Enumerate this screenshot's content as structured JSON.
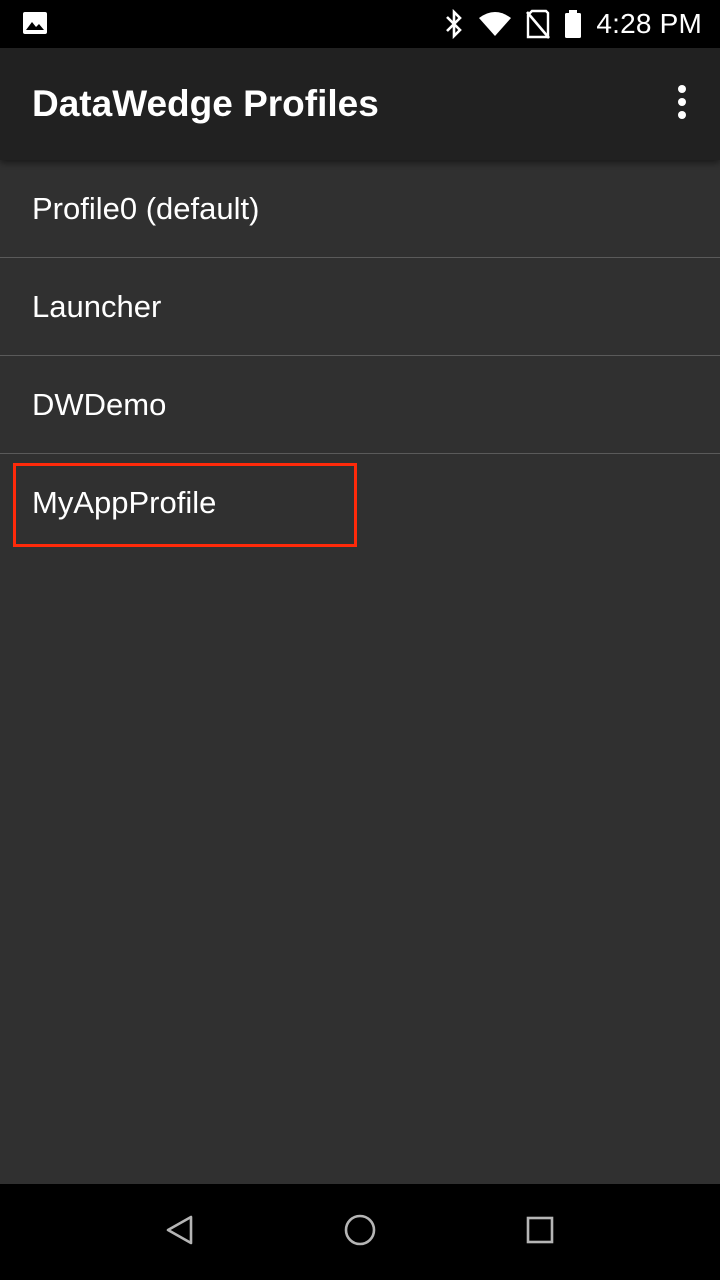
{
  "status_bar": {
    "time": "4:28 PM",
    "icons": [
      "image-notification-icon",
      "bluetooth-icon",
      "wifi-icon",
      "no-sim-icon",
      "battery-icon"
    ]
  },
  "app_bar": {
    "title": "DataWedge Profiles",
    "overflow_icon": "more-vert-icon"
  },
  "profiles": [
    {
      "label": "Profile0 (default)"
    },
    {
      "label": "Launcher"
    },
    {
      "label": "DWDemo"
    },
    {
      "label": "MyAppProfile",
      "highlighted": true
    }
  ],
  "nav_bar": {
    "icons": [
      "back-icon",
      "home-icon",
      "recents-icon"
    ]
  },
  "colors": {
    "background": "#303030",
    "app_bar": "#212121",
    "status_bar": "#000000",
    "divider": "#5a5a5a",
    "highlight": "#ff2a0a",
    "text": "#ffffff"
  }
}
